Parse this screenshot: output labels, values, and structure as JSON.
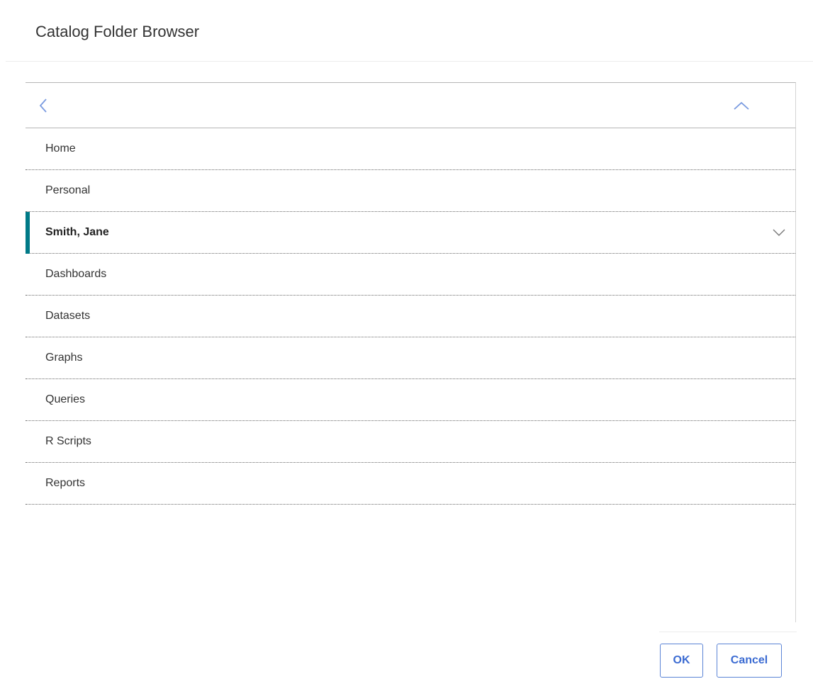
{
  "dialog": {
    "title": "Catalog Folder Browser"
  },
  "nav": {
    "back_icon": "chevron-left-icon",
    "up_icon": "chevron-up-icon"
  },
  "folders": [
    {
      "label": "Home",
      "selected": false
    },
    {
      "label": "Personal",
      "selected": false
    },
    {
      "label": "Smith, Jane",
      "selected": true,
      "expandable": true
    },
    {
      "label": "Dashboards",
      "selected": false
    },
    {
      "label": "Datasets",
      "selected": false
    },
    {
      "label": "Graphs",
      "selected": false
    },
    {
      "label": "Queries",
      "selected": false
    },
    {
      "label": "R Scripts",
      "selected": false
    },
    {
      "label": "Reports",
      "selected": false
    }
  ],
  "buttons": {
    "ok_label": "OK",
    "cancel_label": "Cancel"
  },
  "colors": {
    "accent": "#007a87",
    "button_text": "#3b6bd2",
    "button_border": "#5b84d6",
    "nav_icon": "#7a9be0"
  }
}
